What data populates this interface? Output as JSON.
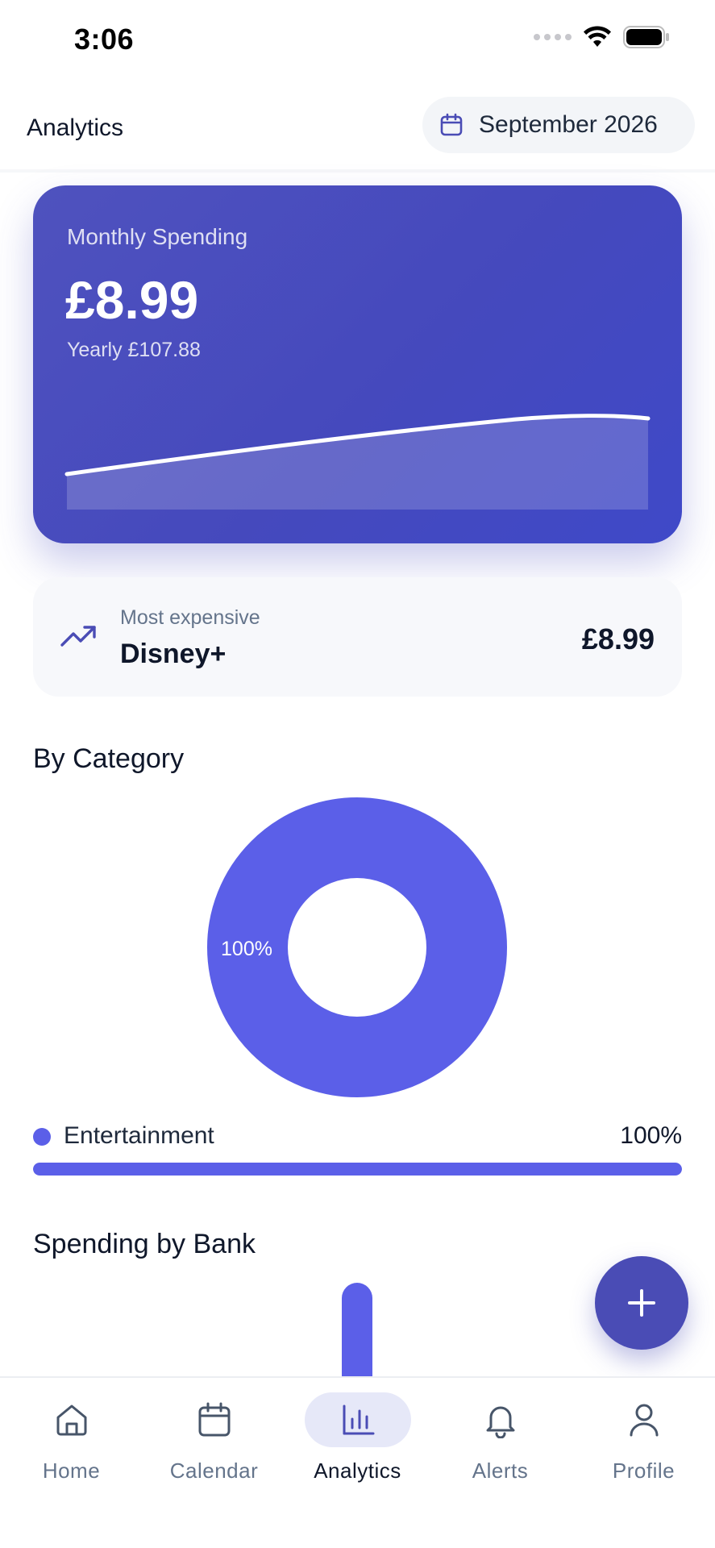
{
  "status_bar": {
    "time": "3:06"
  },
  "header": {
    "title": "Analytics",
    "date_label": "September 2026"
  },
  "summary": {
    "label": "Monthly Spending",
    "amount": "£8.99",
    "yearly": "Yearly £107.88"
  },
  "most_expensive": {
    "label": "Most expensive",
    "name": "Disney+",
    "price": "£8.99"
  },
  "category_section": {
    "title": "By Category",
    "slice_label": "100%",
    "legend": [
      {
        "name": "Entertainment",
        "percent": "100%",
        "fraction": 1.0,
        "color": "#5b5fe8"
      }
    ]
  },
  "bank_section": {
    "title": "Spending by Bank"
  },
  "chart_data": {
    "type": "pie",
    "title": "By Category",
    "categories": [
      "Entertainment"
    ],
    "values": [
      100
    ],
    "donut": true
  },
  "colors": {
    "accent": "#5b5fe8",
    "hero": "#4549bd",
    "fab": "#4a4cb5"
  },
  "fab": {
    "icon": "plus-icon"
  },
  "nav": {
    "items": [
      {
        "label": "Home",
        "icon": "home-icon"
      },
      {
        "label": "Calendar",
        "icon": "calendar-icon"
      },
      {
        "label": "Analytics",
        "icon": "bar-chart-icon",
        "active": true
      },
      {
        "label": "Alerts",
        "icon": "bell-icon"
      },
      {
        "label": "Profile",
        "icon": "user-icon"
      }
    ]
  }
}
